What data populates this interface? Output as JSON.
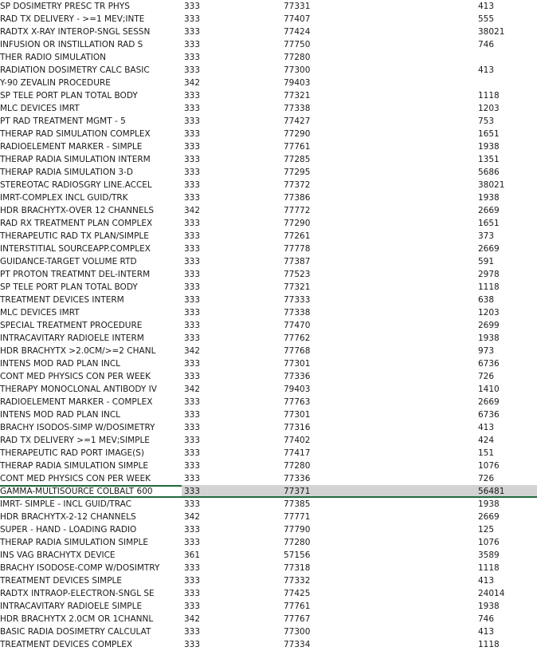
{
  "sheet": {
    "selected_index": 38,
    "rows": [
      {
        "desc": "SP DOSIMETRY PRESC TR PHYS",
        "a": "333",
        "b": "77331",
        "d": "413"
      },
      {
        "desc": "RAD TX DELIVERY - >=1 MEV;INTE",
        "a": "333",
        "b": "77407",
        "d": "555"
      },
      {
        "desc": "RADTX X-RAY INTEROP-SNGL SESSN",
        "a": "333",
        "b": "77424",
        "d": "38021"
      },
      {
        "desc": "INFUSION OR INSTILLATION RAD S",
        "a": "333",
        "b": "77750",
        "d": "746"
      },
      {
        "desc": "THER RADIO SIMULATION",
        "a": "333",
        "b": "77280",
        "d": ""
      },
      {
        "desc": "RADIATION DOSIMETRY CALC BASIC",
        "a": "333",
        "b": "77300",
        "d": "413"
      },
      {
        "desc": "Y-90 ZEVALIN PROCEDURE",
        "a": "342",
        "b": "79403",
        "d": ""
      },
      {
        "desc": "SP TELE PORT PLAN TOTAL BODY",
        "a": "333",
        "b": "77321",
        "d": "1118"
      },
      {
        "desc": "MLC DEVICES IMRT",
        "a": "333",
        "b": "77338",
        "d": "1203"
      },
      {
        "desc": "PT RAD TREATMENT MGMT -  5",
        "a": "333",
        "b": "77427",
        "d": "753"
      },
      {
        "desc": "THERAP RAD SIMULATION COMPLEX",
        "a": "333",
        "b": "77290",
        "d": "1651"
      },
      {
        "desc": "RADIOELEMENT MARKER -  SIMPLE",
        "a": "333",
        "b": "77761",
        "d": "1938"
      },
      {
        "desc": "THERAP RADIA SIMULATION INTERM",
        "a": "333",
        "b": "77285",
        "d": "1351"
      },
      {
        "desc": "THERAP RADIA SIMULATION 3-D",
        "a": "333",
        "b": "77295",
        "d": "5686"
      },
      {
        "desc": "STEREOTAC RADIOSGRY LINE.ACCEL",
        "a": "333",
        "b": "77372",
        "d": "38021"
      },
      {
        "desc": "IMRT-COMPLEX INCL GUID/TRK",
        "a": "333",
        "b": "77386",
        "d": "1938"
      },
      {
        "desc": "HDR BRACHYTX-OVER 12 CHANNELS",
        "a": "342",
        "b": "77772",
        "d": "2669"
      },
      {
        "desc": "RAD RX TREATMENT PLAN COMPLEX",
        "a": "333",
        "b": "77290",
        "d": "1651"
      },
      {
        "desc": "THERAPEUTIC RAD TX PLAN/SIMPLE",
        "a": "333",
        "b": "77261",
        "d": "373"
      },
      {
        "desc": "INTERSTITIAL SOURCEAPP.COMPLEX",
        "a": "333",
        "b": "77778",
        "d": "2669"
      },
      {
        "desc": "GUIDANCE-TARGET VOLUME RTD",
        "a": "333",
        "b": "77387",
        "d": "591"
      },
      {
        "desc": "PT PROTON TREATMNT DEL-INTERM",
        "a": "333",
        "b": "77523",
        "d": "2978"
      },
      {
        "desc": "SP TELE PORT PLAN TOTAL BODY",
        "a": "333",
        "b": "77321",
        "d": "1118"
      },
      {
        "desc": "TREATMENT DEVICES INTERM",
        "a": "333",
        "b": "77333",
        "d": "638"
      },
      {
        "desc": "MLC DEVICES IMRT",
        "a": "333",
        "b": "77338",
        "d": "1203"
      },
      {
        "desc": "SPECIAL TREATMENT PROCEDURE",
        "a": "333",
        "b": "77470",
        "d": "2699"
      },
      {
        "desc": "INTRACAVITARY RADIOELE INTERM",
        "a": "333",
        "b": "77762",
        "d": "1938"
      },
      {
        "desc": "HDR BRACHYTX >2.0CM/>=2 CHANL",
        "a": "342",
        "b": "77768",
        "d": "973"
      },
      {
        "desc": "INTENS MOD RAD PLAN INCL",
        "a": "333",
        "b": "77301",
        "d": "6736"
      },
      {
        "desc": "CONT MED PHYSICS CON PER WEEK",
        "a": "333",
        "b": "77336",
        "d": "726"
      },
      {
        "desc": "THERAPY MONOCLONAL ANTIBODY IV",
        "a": "342",
        "b": "79403",
        "d": "1410"
      },
      {
        "desc": "RADIOELEMENT MARKER -  COMPLEX",
        "a": "333",
        "b": "77763",
        "d": "2669"
      },
      {
        "desc": "INTENS MOD RAD PLAN INCL",
        "a": "333",
        "b": "77301",
        "d": "6736"
      },
      {
        "desc": "BRACHY ISODOS-SIMP W/DOSIMETRY",
        "a": "333",
        "b": "77316",
        "d": "413"
      },
      {
        "desc": "RAD TX DELIVERY >=1 MEV;SIMPLE",
        "a": "333",
        "b": "77402",
        "d": "424"
      },
      {
        "desc": "THERAPEUTIC RAD PORT IMAGE(S)",
        "a": "333",
        "b": "77417",
        "d": "151"
      },
      {
        "desc": "THERAP RADIA SIMULATION SIMPLE",
        "a": "333",
        "b": "77280",
        "d": "1076"
      },
      {
        "desc": "CONT MED PHYSICS CON PER WEEK",
        "a": "333",
        "b": "77336",
        "d": "726"
      },
      {
        "desc": "GAMMA-MULTISOURCE COLBALT 600",
        "a": "333",
        "b": "77371",
        "d": "56481"
      },
      {
        "desc": "IMRT- SIMPLE -  INCL GUID/TRAC",
        "a": "333",
        "b": "77385",
        "d": "1938"
      },
      {
        "desc": "HDR BRACHYTX-2-12 CHANNELS",
        "a": "342",
        "b": "77771",
        "d": "2669"
      },
      {
        "desc": "SUPER -  HAND -  LOADING RADIO",
        "a": "333",
        "b": "77790",
        "d": "125"
      },
      {
        "desc": "THERAP RADIA SIMULATION SIMPLE",
        "a": "333",
        "b": "77280",
        "d": "1076"
      },
      {
        "desc": "INS VAG BRACHYTX DEVICE",
        "a": "361",
        "b": "57156",
        "d": "3589"
      },
      {
        "desc": "BRACHY ISODOSE-COMP W/DOSIMTRY",
        "a": "333",
        "b": "77318",
        "d": "1118"
      },
      {
        "desc": "TREATMENT DEVICES SIMPLE",
        "a": "333",
        "b": "77332",
        "d": "413"
      },
      {
        "desc": "RADTX INTRAOP-ELECTRON-SNGL SE",
        "a": "333",
        "b": "77425",
        "d": "24014"
      },
      {
        "desc": "INTRACAVITARY RADIOELE SIMPLE",
        "a": "333",
        "b": "77761",
        "d": "1938"
      },
      {
        "desc": "HDR BRACHYTX 2.0CM OR 1CHANNL",
        "a": "342",
        "b": "77767",
        "d": "746"
      },
      {
        "desc": "BASIC RADIA DOSIMETRY CALCULAT",
        "a": "333",
        "b": "77300",
        "d": "413"
      },
      {
        "desc": "TREATMENT DEVICES COMPLEX",
        "a": "333",
        "b": "77334",
        "d": "1118"
      }
    ]
  }
}
